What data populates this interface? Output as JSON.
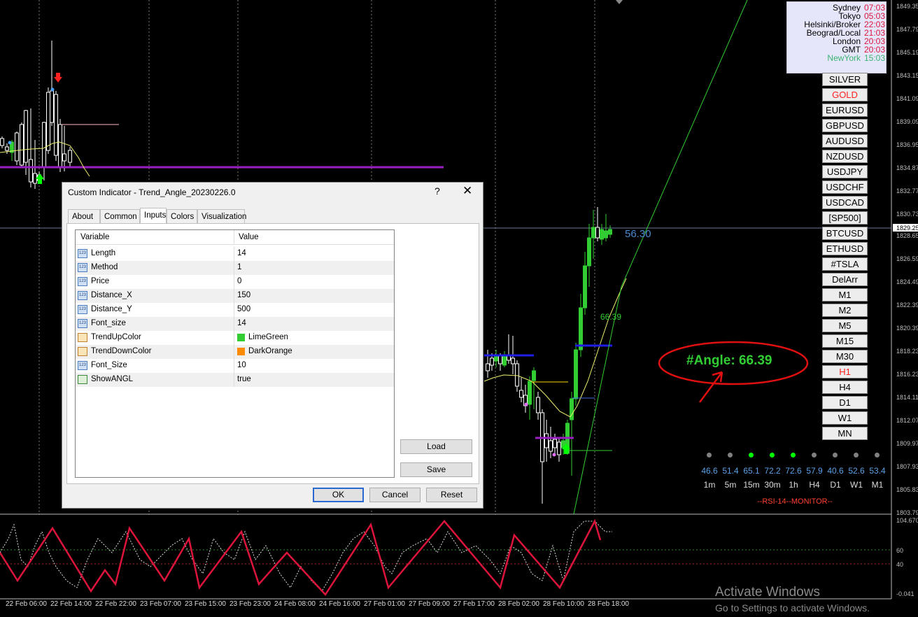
{
  "colors": {
    "bull": "#32cd32",
    "bear": "#ffffff",
    "ma": "#f0f070",
    "purple": "#9a1ec0",
    "blue": "#1e1ee6",
    "rsi": "#dc143c",
    "trend": "#32cd32"
  },
  "clocks": [
    {
      "name": "Sydney",
      "time": "07:03"
    },
    {
      "name": "Tokyo",
      "time": "05:03"
    },
    {
      "name": "Helsinki/Broker",
      "time": "22:03"
    },
    {
      "name": "Beograd/Local",
      "time": "21:03"
    },
    {
      "name": "London",
      "time": "20:03"
    },
    {
      "name": "GMT",
      "time": "20:03"
    },
    {
      "name": "NewYork",
      "time": "15:03",
      "highlight": true
    }
  ],
  "symbols": [
    "SILVER",
    "GOLD",
    "EURUSD",
    "GBPUSD",
    "AUDUSD",
    "NZDUSD",
    "USDJPY",
    "USDCHF",
    "USDCAD",
    "[SP500]",
    "BTCUSD",
    "ETHUSD",
    "#TSLA",
    "DelArr",
    "M1",
    "M2",
    "M5",
    "M15",
    "M30",
    "H1",
    "H4",
    "D1",
    "W1",
    "MN"
  ],
  "symbols_red": [
    "GOLD",
    "H1"
  ],
  "price_labels": [
    "1849.35",
    "1847.79",
    "1845.19",
    "1843.15",
    "1841.09",
    "1839.09",
    "1836.95",
    "1834.87",
    "1832.77",
    "1830.73",
    "1829.25",
    "1828.65",
    "1826.59",
    "1824.49",
    "1822.39",
    "1820.39",
    "1818.23",
    "1816.23",
    "1814.11",
    "1812.07",
    "1809.97",
    "1807.93",
    "1805.83",
    "1803.79"
  ],
  "rsi_labels": [
    "104.670",
    "60",
    "40",
    "-0.041"
  ],
  "time_labels": [
    "22 Feb 06:00",
    "22 Feb 14:00",
    "22 Feb 22:00",
    "23 Feb 07:00",
    "23 Feb 15:00",
    "23 Feb 23:00",
    "24 Feb 08:00",
    "24 Feb 16:00",
    "27 Feb 01:00",
    "27 Feb 09:00",
    "27 Feb 17:00",
    "28 Feb 02:00",
    "28 Feb 10:00",
    "28 Feb 18:00"
  ],
  "chart_labels": {
    "angle_line_value": "56.30",
    "angle_value": "66.39",
    "angle_text": "#Angle: 66.39",
    "rsi_monitor": "--RSI-14--MONITOR--"
  },
  "rsi_monitor": {
    "values": [
      "46.6",
      "51.4",
      "65.1",
      "72.2",
      "72.6",
      "57.9",
      "40.6",
      "52.6",
      "53.4"
    ],
    "timeframes": [
      "1m",
      "5m",
      "15m",
      "30m",
      "1h",
      "H4",
      "D1",
      "W1",
      "M1"
    ],
    "dot_colors": [
      "#808080",
      "#808080",
      "#00ff00",
      "#00ff00",
      "#00ff00",
      "#808080",
      "#808080",
      "#808080",
      "#808080"
    ]
  },
  "dialog": {
    "title": "Custom Indicator - Trend_Angle_20230226.0",
    "help": "?",
    "close": "✕",
    "tabs": [
      "About",
      "Common",
      "Inputs",
      "Colors",
      "Visualization"
    ],
    "active_tab": "Inputs",
    "col_variable": "Variable",
    "col_value": "Value",
    "rows": [
      {
        "icon": "123",
        "variable": "Length",
        "value": "14"
      },
      {
        "icon": "123",
        "variable": "Method",
        "value": "1"
      },
      {
        "icon": "123",
        "variable": "Price",
        "value": "0"
      },
      {
        "icon": "123",
        "variable": "Distance_X",
        "value": "150"
      },
      {
        "icon": "123",
        "variable": "Distance_Y",
        "value": "500"
      },
      {
        "icon": "123",
        "variable": "Font_size",
        "value": "14"
      },
      {
        "icon": "color",
        "variable": "TrendUpColor",
        "value": "LimeGreen",
        "swatch": "#32cd32"
      },
      {
        "icon": "color",
        "variable": "TrendDownColor",
        "value": "DarkOrange",
        "swatch": "#ff8c00"
      },
      {
        "icon": "123",
        "variable": "Font_Size",
        "value": "10"
      },
      {
        "icon": "bool",
        "variable": "ShowANGL",
        "value": "true"
      }
    ],
    "load": "Load",
    "save": "Save",
    "ok": "OK",
    "cancel": "Cancel",
    "reset": "Reset"
  },
  "watermark": {
    "line1": "Activate Windows",
    "line2": "Go to Settings to activate Windows."
  }
}
